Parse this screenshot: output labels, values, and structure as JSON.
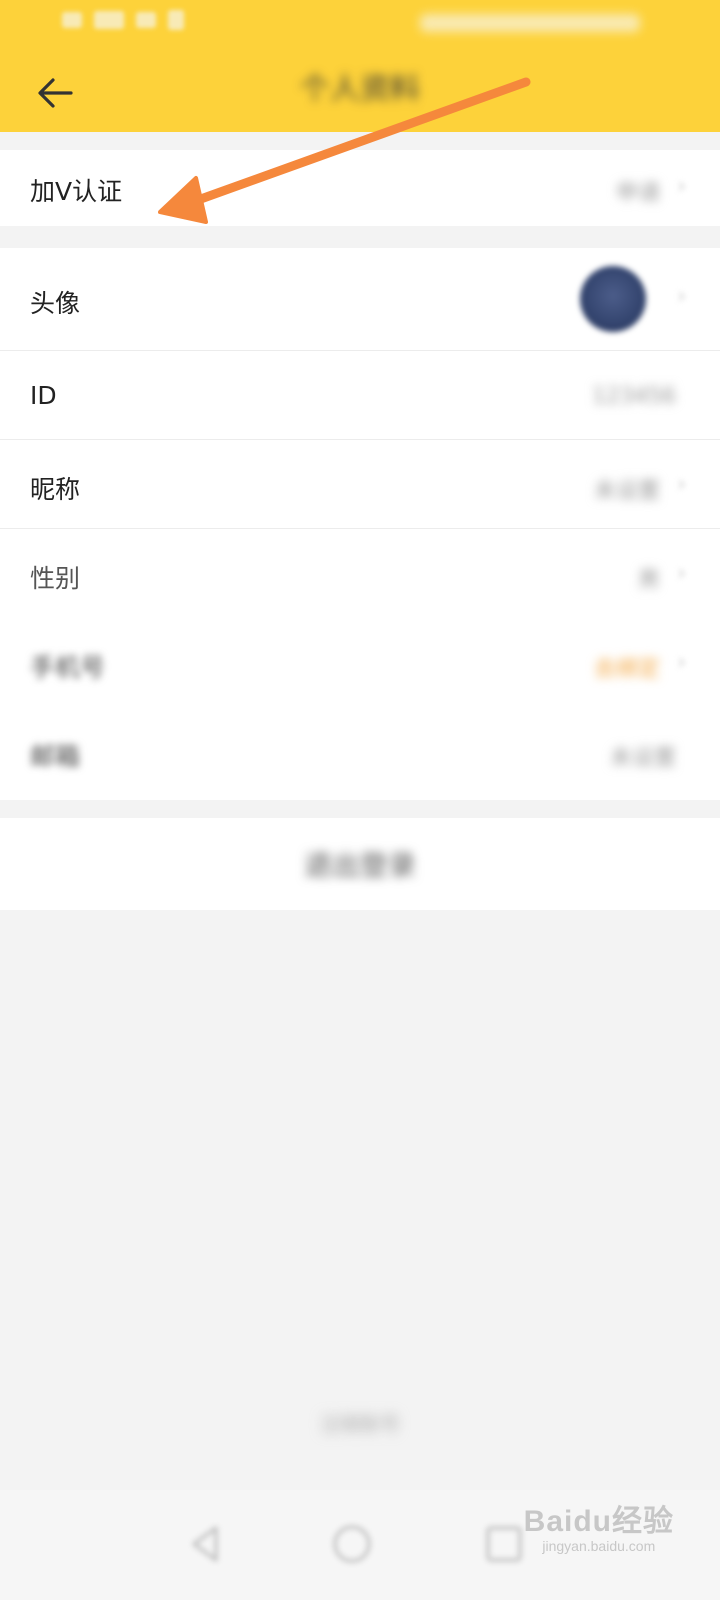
{
  "header": {
    "title": "个人资料",
    "back_icon": "arrow-left-icon",
    "background": "#fdd23a"
  },
  "verify_row": {
    "label": "加V认证",
    "value": "申请"
  },
  "profile_rows": [
    {
      "label": "头像",
      "value": ""
    },
    {
      "label": "ID",
      "value": "123456"
    },
    {
      "label": "昵称",
      "value": "未设置"
    },
    {
      "label": "性别",
      "value": "男"
    },
    {
      "label": "手机号",
      "value": "去绑定"
    },
    {
      "label": "邮箱",
      "value": "未设置"
    }
  ],
  "logout": {
    "label": "退出登录"
  },
  "footer": {
    "text": "注销账号"
  },
  "annotation": {
    "color": "#f5883c"
  },
  "watermark": {
    "brand": "Baidu经验",
    "url": "jingyan.baidu.com"
  }
}
